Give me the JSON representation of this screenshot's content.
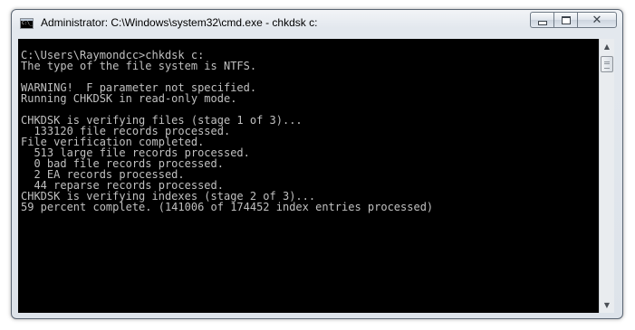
{
  "window": {
    "title": "Administrator: C:\\Windows\\system32\\cmd.exe - chkdsk  c:",
    "icon": "cmd-console-icon",
    "controls": {
      "minimize": "minimize-icon",
      "maximize": "maximize-icon",
      "close": "✕"
    }
  },
  "console": {
    "lines": [
      "",
      "C:\\Users\\Raymondcc>chkdsk c:",
      "The type of the file system is NTFS.",
      "",
      "WARNING!  F parameter not specified.",
      "Running CHKDSK in read-only mode.",
      "",
      "CHKDSK is verifying files (stage 1 of 3)...",
      "  133120 file records processed.",
      "File verification completed.",
      "  513 large file records processed.",
      "  0 bad file records processed.",
      "  2 EA records processed.",
      "  44 reparse records processed.",
      "CHKDSK is verifying indexes (stage 2 of 3)...",
      "59 percent complete. (141006 of 174452 index entries processed)"
    ],
    "text_color": "#c0c0c0",
    "background": "#000000"
  },
  "scrollbar": {
    "up": "▲",
    "down": "▼"
  }
}
